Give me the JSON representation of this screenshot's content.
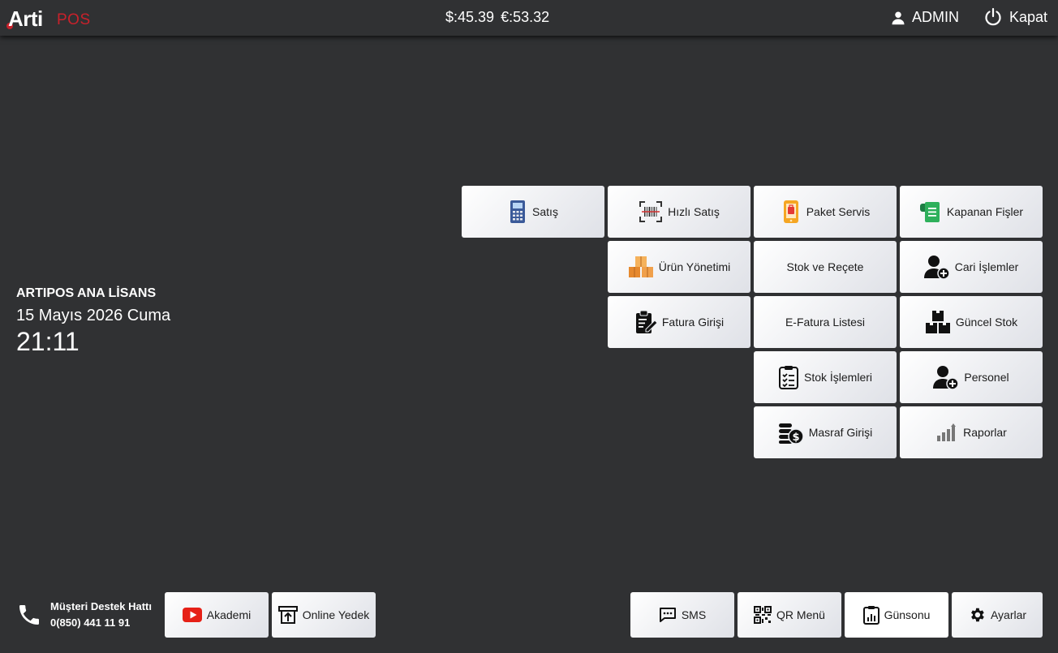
{
  "header": {
    "logo_text": "Arti",
    "logo_suffix": "POS",
    "usd": "$:45.39",
    "eur": "€:53.32",
    "user": "ADMIN",
    "logout": "Kapat"
  },
  "info": {
    "license": "ARTIPOS ANA LİSANS",
    "date": "15 Mayıs 2026 Cuma",
    "time": "21:11"
  },
  "tiles": {
    "satis": "Satış",
    "hizli_satis": "Hızlı Satış",
    "paket_servis": "Paket Servis",
    "kapanan_fisler": "Kapanan Fişler",
    "urun_yonetimi": "Ürün Yönetimi",
    "stok_recete": "Stok ve Reçete",
    "cari_islemler": "Cari İşlemler",
    "fatura_girisi": "Fatura Girişi",
    "efatura_listesi": "E-Fatura Listesi",
    "guncel_stok": "Güncel Stok",
    "stok_islemleri": "Stok İşlemleri",
    "personel": "Personel",
    "masraf_girisi": "Masraf Girişi",
    "raporlar": "Raporlar"
  },
  "footer": {
    "support_title": "Müşteri Destek Hattı",
    "support_phone": "0(850) 441 11 91",
    "akademi": "Akademi",
    "online_yedek": "Online Yedek",
    "sms": "SMS",
    "qr_menu": "QR Menü",
    "gunsonu": "Günsonu",
    "ayarlar": "Ayarlar"
  },
  "colors": {
    "background": "#303133",
    "brand_red": "#c8212b",
    "tile_light": "#ffffff",
    "tile_dark": "#dfe1e7"
  },
  "icons": {
    "satis": "pos-terminal-icon",
    "hizli_satis": "barcode-scan-icon",
    "paket_servis": "phone-order-icon",
    "kapanan_fisler": "receipt-icon",
    "urun_yonetimi": "boxes-icon",
    "cari_islemler": "user-add-icon",
    "fatura_girisi": "invoice-edit-icon",
    "guncel_stok": "stacked-boxes-icon",
    "stok_islemleri": "checklist-icon",
    "personel": "user-add-icon",
    "masraf_girisi": "coins-icon",
    "raporlar": "bar-chart-icon"
  }
}
